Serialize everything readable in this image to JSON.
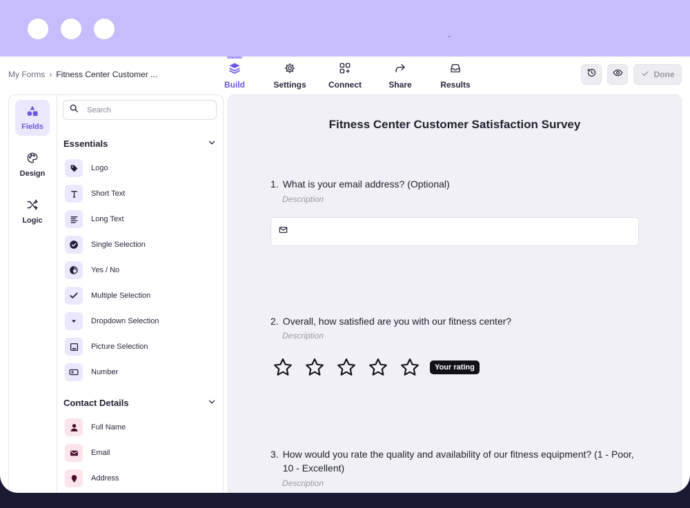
{
  "header": {
    "breadcrumb": {
      "root": "My Forms",
      "separator": "›",
      "current": "Fitness Center Customer ..."
    },
    "tabs": [
      {
        "label": "Build",
        "icon": "layers-icon",
        "active": true
      },
      {
        "label": "Settings",
        "icon": "gear-icon",
        "active": false
      },
      {
        "label": "Connect",
        "icon": "apps-plus-icon",
        "active": false
      },
      {
        "label": "Share",
        "icon": "share-arrow-icon",
        "active": false
      },
      {
        "label": "Results",
        "icon": "inbox-icon",
        "active": false
      }
    ],
    "actions": {
      "history_icon": "history-icon",
      "preview_icon": "eye-icon",
      "done_label": "Done"
    }
  },
  "rail": {
    "items": [
      {
        "label": "Fields",
        "icon": "shapes-icon",
        "active": true
      },
      {
        "label": "Design",
        "icon": "palette-icon",
        "active": false
      },
      {
        "label": "Logic",
        "icon": "shuffle-icon",
        "active": false
      }
    ]
  },
  "panel": {
    "search_placeholder": "Search",
    "sections": [
      {
        "title": "Essentials",
        "items": [
          {
            "label": "Logo",
            "icon": "tag-icon"
          },
          {
            "label": "Short Text",
            "icon": "text-t-icon"
          },
          {
            "label": "Long Text",
            "icon": "paragraph-icon"
          },
          {
            "label": "Single Selection",
            "icon": "check-circle-icon"
          },
          {
            "label": "Yes / No",
            "icon": "yes-no-icon"
          },
          {
            "label": "Multiple Selection",
            "icon": "check-icon"
          },
          {
            "label": "Dropdown Selection",
            "icon": "caret-down-icon"
          },
          {
            "label": "Picture Selection",
            "icon": "image-icon"
          },
          {
            "label": "Number",
            "icon": "number-field-icon"
          }
        ]
      },
      {
        "title": "Contact Details",
        "items": [
          {
            "label": "Full Name",
            "icon": "person-icon"
          },
          {
            "label": "Email",
            "icon": "envelope-icon"
          },
          {
            "label": "Address",
            "icon": "map-pin-icon"
          }
        ]
      }
    ]
  },
  "form": {
    "title": "Fitness Center Customer Satisfaction Survey",
    "questions": [
      {
        "number": "1.",
        "text": "What is your email address? (Optional)",
        "description": "Description"
      },
      {
        "number": "2.",
        "text": "Overall, how satisfied are you with our fitness center?",
        "description": "Description",
        "rating_badge": "Your rating",
        "stars": 5
      },
      {
        "number": "3.",
        "text_line1": "How would you rate the quality and availability of our fitness equipment? (1 - Poor,",
        "text_line2": "10 - Excellent)",
        "description": "Description"
      }
    ]
  },
  "colors": {
    "accent": "#6b56e0",
    "topband": "#c7bdfd",
    "canvas": "#f0f0f6",
    "dark_bg": "#1b1a33"
  }
}
